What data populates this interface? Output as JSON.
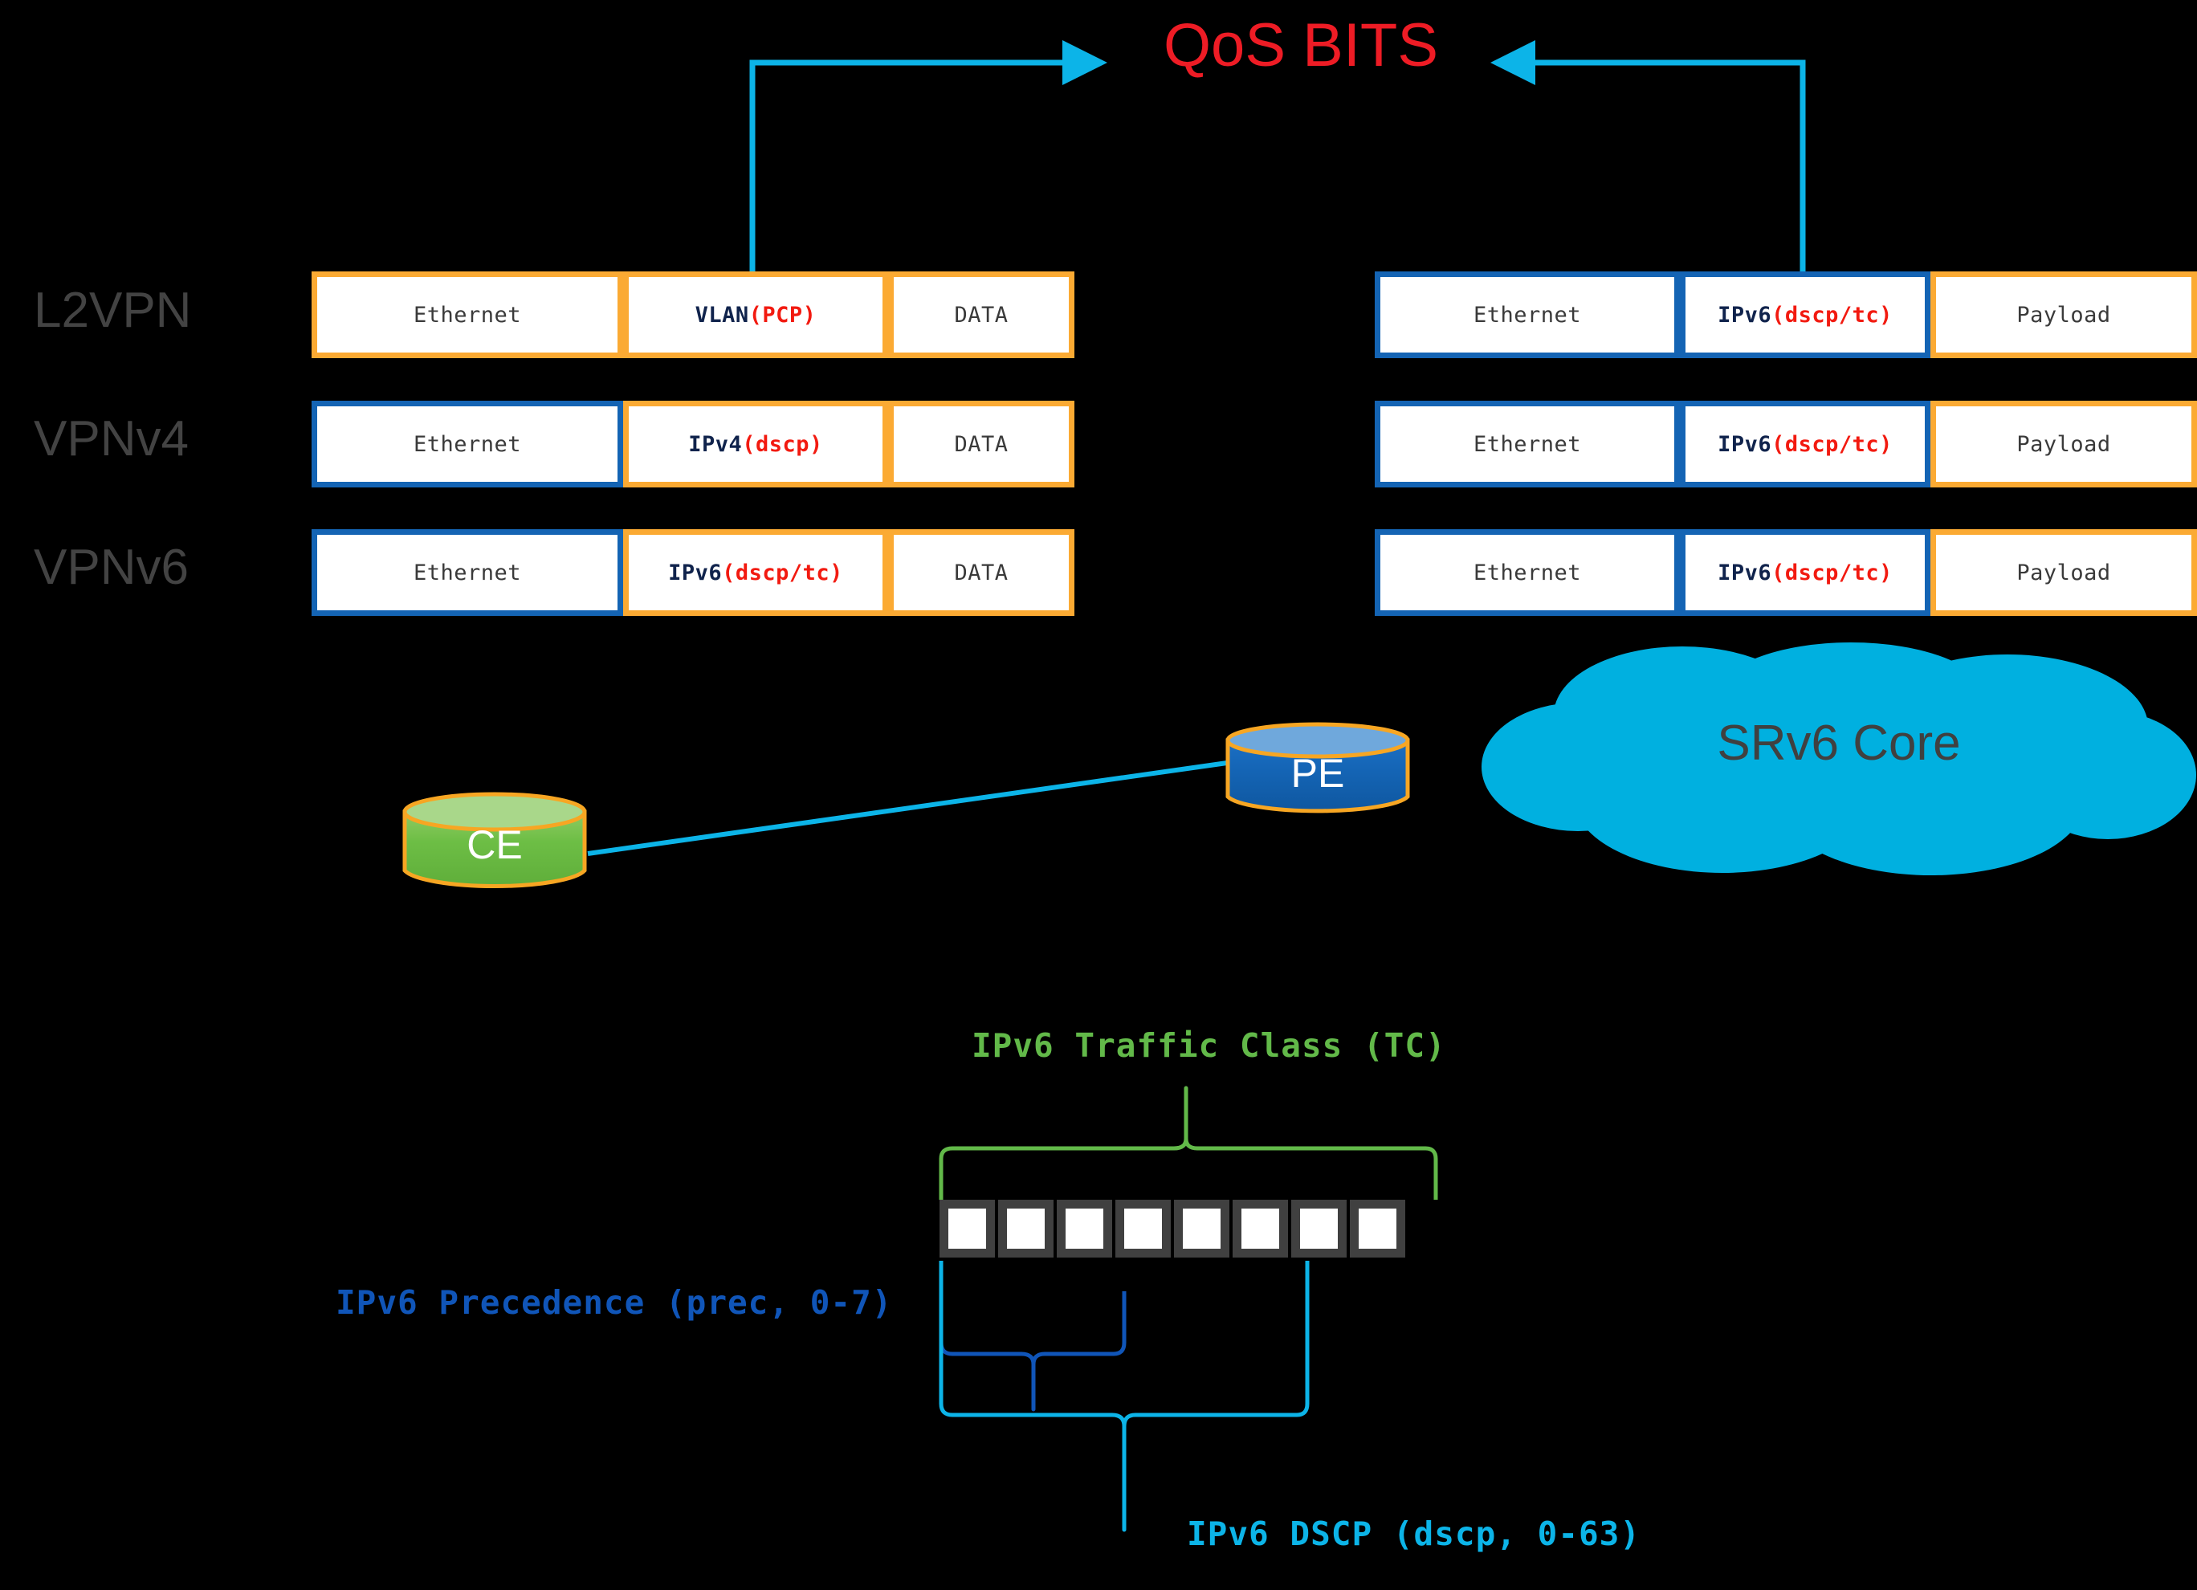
{
  "title": {
    "qos_bits": "QoS BITS",
    "color": "#EE1C25"
  },
  "row_labels": {
    "l2vpn": "L2VPN",
    "vpnv4": "VPNv4",
    "vpnv6": "VPNv6",
    "color": "#434343"
  },
  "colors": {
    "orange_border": "#FBAA33",
    "blue_border": "#1464B4",
    "cyan_arrow": "#0CB4E8",
    "cloud_fill": "#00B0E0",
    "ce_fill": "#6DBE45",
    "pe_fill": "#1464B4",
    "cyl_border": "#F7A623",
    "bit_border": "#404040",
    "tc_green": "#62B949",
    "prec_blue": "#1055B8",
    "dscp_cyan": "#0CB4E8",
    "keyword_navy": "#10234C",
    "keyword_red": "#F21A10",
    "background": "#000000"
  },
  "packets": {
    "left": [
      {
        "row": "l2vpn",
        "cells": [
          {
            "text": "Ethernet",
            "border": "orange",
            "style": "plain"
          },
          {
            "text": "VLAN (PCP)",
            "border": "orange",
            "style": "keyword",
            "keyword": "VLAN ",
            "value": "(PCP)"
          },
          {
            "text": "DATA",
            "border": "orange",
            "style": "plain"
          }
        ]
      },
      {
        "row": "vpnv4",
        "cells": [
          {
            "text": "Ethernet",
            "border": "blue",
            "style": "plain"
          },
          {
            "text": "IPv4(dscp)",
            "border": "orange",
            "style": "keyword",
            "keyword": "IPv4",
            "value": "(dscp)"
          },
          {
            "text": "DATA",
            "border": "orange",
            "style": "plain"
          }
        ]
      },
      {
        "row": "vpnv6",
        "cells": [
          {
            "text": "Ethernet",
            "border": "blue",
            "style": "plain"
          },
          {
            "text": "IPv6(dscp/tc)",
            "border": "orange",
            "style": "keyword",
            "keyword": "IPv6",
            "value": "(dscp/tc)"
          },
          {
            "text": "DATA",
            "border": "orange",
            "style": "plain"
          }
        ]
      }
    ],
    "right": [
      {
        "row": "l2vpn",
        "cells": [
          {
            "text": "Ethernet",
            "border": "blue",
            "style": "plain"
          },
          {
            "text": "IPv6(dscp/tc)",
            "border": "blue",
            "style": "keyword",
            "keyword": "IPv6",
            "value": "(dscp/tc)"
          },
          {
            "text": "Payload",
            "border": "orange",
            "style": "plain"
          }
        ]
      },
      {
        "row": "vpnv4",
        "cells": [
          {
            "text": "Ethernet",
            "border": "blue",
            "style": "plain"
          },
          {
            "text": "IPv6(dscp/tc)",
            "border": "blue",
            "style": "keyword",
            "keyword": "IPv6",
            "value": "(dscp/tc)"
          },
          {
            "text": "Payload",
            "border": "orange",
            "style": "plain"
          }
        ]
      },
      {
        "row": "vpnv6",
        "cells": [
          {
            "text": "Ethernet",
            "border": "blue",
            "style": "plain"
          },
          {
            "text": "IPv6(dscp/tc)",
            "border": "blue",
            "style": "keyword",
            "keyword": "IPv6",
            "value": "(dscp/tc)"
          },
          {
            "text": "Payload",
            "border": "orange",
            "style": "plain"
          }
        ]
      }
    ]
  },
  "topology": {
    "ce_label": "CE",
    "pe_label": "PE",
    "cloud_label": "SRv6 Core"
  },
  "bitfield": {
    "bit_count": 8,
    "tc_label": "IPv6 Traffic Class (TC)",
    "prec_label": "IPv6 Precedence (prec, 0-7)",
    "dscp_label": "IPv6 DSCP (dscp, 0-63)",
    "tc_bits": 8,
    "prec_bits": 3,
    "dscp_bits": 6
  }
}
